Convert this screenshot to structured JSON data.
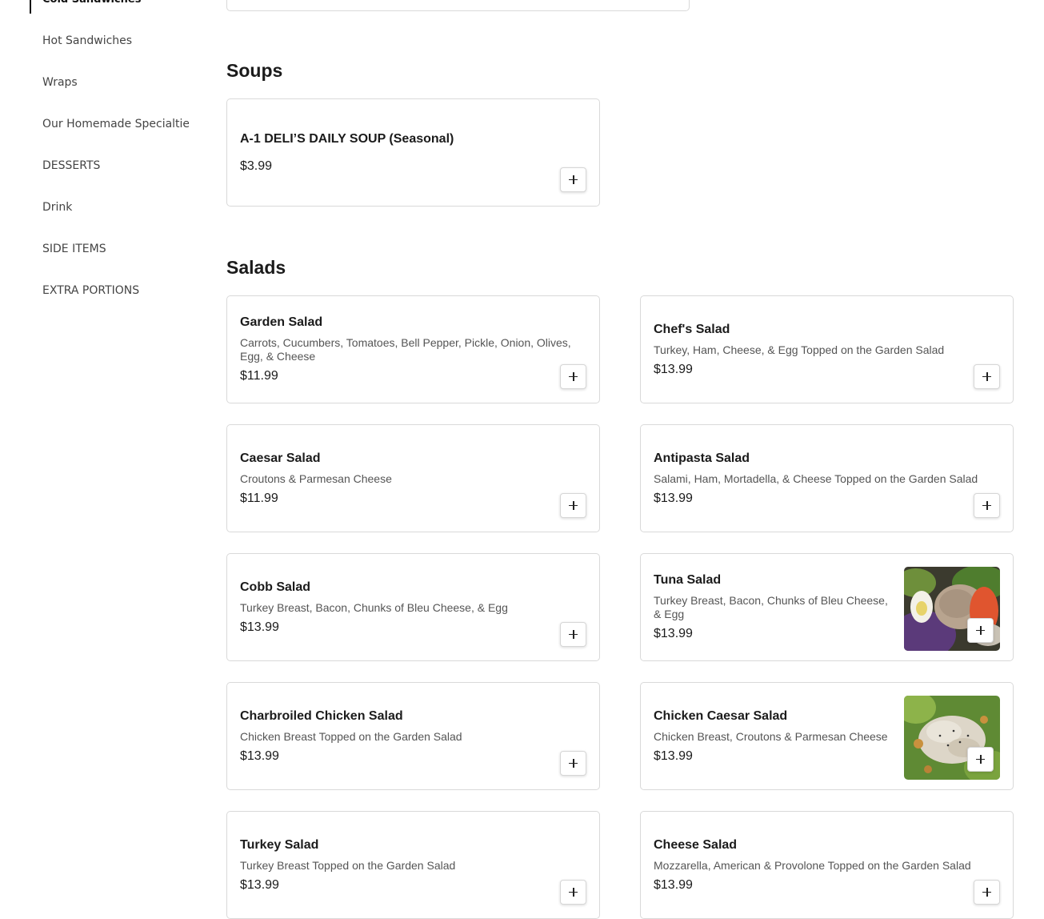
{
  "sidebar": {
    "items": [
      {
        "label": "Cold Sandwiches",
        "active": true
      },
      {
        "label": "Hot Sandwiches"
      },
      {
        "label": "Wraps"
      },
      {
        "label": "Our Homemade Specialties"
      },
      {
        "label": "DESSERTS"
      },
      {
        "label": "Drink"
      },
      {
        "label": "SIDE ITEMS"
      },
      {
        "label": "EXTRA PORTIONS"
      }
    ]
  },
  "sections": {
    "soups": {
      "title": "Soups",
      "items": [
        {
          "name": "A-1 DELI’S DAILY SOUP (Seasonal)",
          "price": "$3.99"
        }
      ]
    },
    "salads": {
      "title": "Salads",
      "items": [
        {
          "name": "Garden Salad",
          "description": "Carrots, Cucumbers, Tomatoes, Bell Pepper, Pickle, Onion, Olives, Egg, & Cheese",
          "price": "$11.99"
        },
        {
          "name": "Chef's Salad",
          "description": "Turkey, Ham, Cheese, & Egg Topped on the Garden Salad",
          "price": "$13.99"
        },
        {
          "name": "Caesar Salad",
          "description": "Croutons & Parmesan Cheese",
          "price": "$11.99"
        },
        {
          "name": "Antipasta Salad",
          "description": "Salami, Ham, Mortadella, & Cheese Topped on the Garden Salad",
          "price": "$13.99"
        },
        {
          "name": "Cobb Salad",
          "description": "Turkey Breast, Bacon, Chunks of Bleu Cheese, & Egg",
          "price": "$13.99"
        },
        {
          "name": "Tuna Salad",
          "description": "Turkey Breast, Bacon, Chunks of Bleu Cheese, & Egg",
          "price": "$13.99",
          "image": "tuna-salad-photo"
        },
        {
          "name": "Charbroiled Chicken Salad",
          "description": "Chicken Breast Topped on the Garden Salad",
          "price": "$13.99"
        },
        {
          "name": "Chicken Caesar Salad",
          "description": "Chicken Breast, Croutons & Parmesan Cheese",
          "price": "$13.99",
          "image": "chicken-caesar-salad-photo"
        },
        {
          "name": "Turkey Salad",
          "description": "Turkey Breast Topped on the Garden Salad",
          "price": "$13.99"
        },
        {
          "name": "Cheese Salad",
          "description": "Mozzarella, American & Provolone Topped on the Garden Salad",
          "price": "$13.99"
        }
      ]
    }
  },
  "icons": {
    "add": "plus-icon"
  }
}
